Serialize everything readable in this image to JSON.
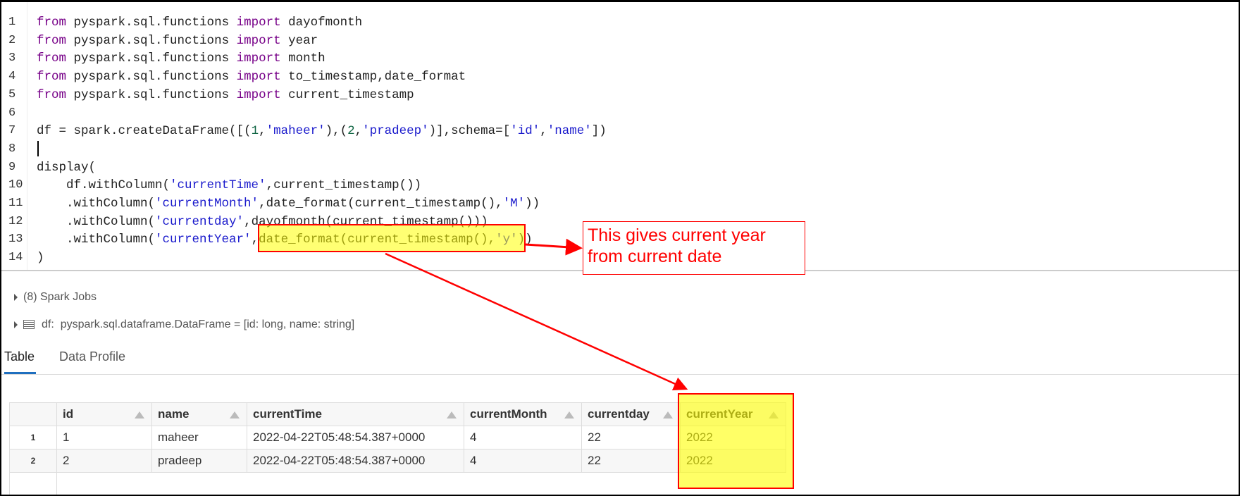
{
  "code": {
    "line_numbers": [
      "1",
      "2",
      "3",
      "4",
      "5",
      "6",
      "7",
      "8",
      "9",
      "10",
      "11",
      "12",
      "13",
      "14"
    ],
    "lines": [
      [
        [
          "kw",
          "from"
        ],
        [
          "",
          "pyspark.sql.functions "
        ],
        [
          "kw",
          "import"
        ],
        [
          "",
          " dayofmonth"
        ]
      ],
      [
        [
          "kw",
          "from"
        ],
        [
          "",
          "pyspark.sql.functions "
        ],
        [
          "kw",
          "import"
        ],
        [
          "",
          " year"
        ]
      ],
      [
        [
          "kw",
          "from"
        ],
        [
          "",
          "pyspark.sql.functions "
        ],
        [
          "kw",
          "import"
        ],
        [
          "",
          " month"
        ]
      ],
      [
        [
          "kw",
          "from"
        ],
        [
          "",
          "pyspark.sql.functions "
        ],
        [
          "kw",
          "import"
        ],
        [
          "",
          " to_timestamp,date_format"
        ]
      ],
      [
        [
          "kw",
          "from"
        ],
        [
          "",
          "pyspark.sql.functions "
        ],
        [
          "kw",
          "import"
        ],
        [
          "",
          " current_timestamp"
        ]
      ],
      [],
      [
        [
          "",
          "df = spark.createDataFrame([("
        ],
        [
          "nm",
          "1"
        ],
        [
          "",
          ","
        ],
        [
          "st",
          "'maheer'"
        ],
        [
          "",
          "),("
        ],
        [
          "nm",
          "2"
        ],
        [
          "",
          ","
        ],
        [
          "st",
          "'pradeep'"
        ],
        [
          "",
          ")],schema=["
        ],
        [
          "st",
          "'id'"
        ],
        [
          "",
          ","
        ],
        [
          "st",
          "'name'"
        ],
        [
          "",
          "])"
        ]
      ],
      [],
      [
        [
          "",
          "display("
        ]
      ],
      [
        [
          "",
          "    df.withColumn("
        ],
        [
          "st",
          "'currentTime'"
        ],
        [
          "",
          ",current_timestamp())"
        ]
      ],
      [
        [
          "",
          "    .withColumn("
        ],
        [
          "st",
          "'currentMonth'"
        ],
        [
          "",
          ",date_format(current_timestamp(),"
        ],
        [
          "st",
          "'M'"
        ],
        [
          "",
          "))"
        ]
      ],
      [
        [
          "",
          "    .withColumn("
        ],
        [
          "st",
          "'currentday'"
        ],
        [
          "",
          ",dayofmonth(current_timestamp()))"
        ]
      ],
      [
        [
          "",
          "    .withColumn("
        ],
        [
          "st",
          "'currentYear'"
        ],
        [
          "",
          ",date_format(current_timestamp(),"
        ],
        [
          "st",
          "'y'"
        ],
        [
          "",
          "))"
        ]
      ],
      [
        [
          "",
          ")"
        ]
      ]
    ]
  },
  "annotation": {
    "line1": "This gives current year",
    "line2": "from current date"
  },
  "output": {
    "spark_jobs": "(8) Spark Jobs",
    "df_label": "df:",
    "df_schema": "pyspark.sql.dataframe.DataFrame = [id: long, name: string]"
  },
  "tabs": [
    {
      "label": "Table",
      "active": true
    },
    {
      "label": "Data Profile",
      "active": false
    }
  ],
  "table": {
    "headers": [
      "id",
      "name",
      "currentTime",
      "currentMonth",
      "currentday",
      "currentYear"
    ],
    "rows": [
      {
        "n": "1",
        "cells": [
          "1",
          "maheer",
          "2022-04-22T05:48:54.387+0000",
          "4",
          "22",
          "2022"
        ]
      },
      {
        "n": "2",
        "cells": [
          "2",
          "pradeep",
          "2022-04-22T05:48:54.387+0000",
          "4",
          "22",
          "2022"
        ]
      }
    ]
  },
  "colors": {
    "highlight": "#ffff00",
    "annotation": "#ff0000",
    "tab_accent": "#1f6fbf"
  }
}
